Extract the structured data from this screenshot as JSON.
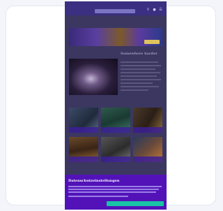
{
  "site": {
    "logo_text": ""
  },
  "search": {
    "placeholder": ""
  },
  "banner": {
    "text": "",
    "cta": ""
  },
  "featured": {
    "title": "Somewhere harder"
  },
  "tiles": [
    {
      "caption": ""
    },
    {
      "caption": ""
    },
    {
      "caption": ""
    },
    {
      "caption": ""
    },
    {
      "caption": ""
    },
    {
      "caption": ""
    }
  ],
  "consent": {
    "title": "Datenschutzeinstellungen",
    "settings_label": "",
    "accept_label": ""
  },
  "colors": {
    "brand": "#5212b8",
    "accept": "#19c3a6",
    "topbar": "#3a2f80"
  },
  "icons": [
    "search-icon",
    "user-icon",
    "menu-icon"
  ]
}
